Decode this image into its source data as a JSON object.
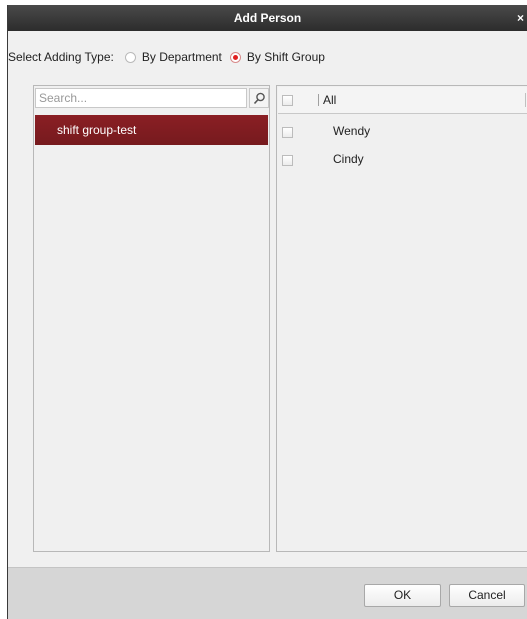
{
  "dialog": {
    "title": "Add Person",
    "close_glyph": "×"
  },
  "adding_type": {
    "label": "Select Adding Type:",
    "options": [
      {
        "label": "By Department",
        "selected": false
      },
      {
        "label": "By Shift Group",
        "selected": true
      }
    ]
  },
  "left_panel": {
    "search_placeholder": "Search...",
    "search_icon": "search-icon",
    "groups": [
      {
        "label": "shift group-test",
        "selected": true
      }
    ]
  },
  "right_panel": {
    "header_label": "All",
    "persons": [
      {
        "name": "Wendy",
        "checked": false
      },
      {
        "name": "Cindy",
        "checked": false
      }
    ]
  },
  "footer": {
    "ok_label": "OK",
    "cancel_label": "Cancel"
  },
  "colors": {
    "title_bar": "#2c2c2c",
    "selected_group": "#7f1d21",
    "radio_checked": "#e02020"
  }
}
